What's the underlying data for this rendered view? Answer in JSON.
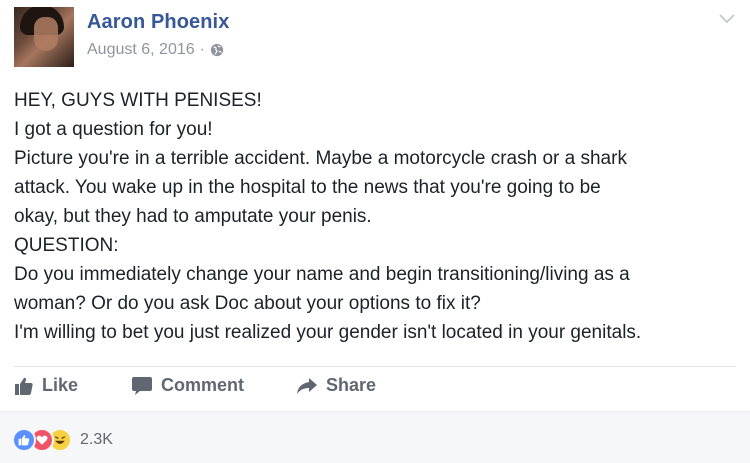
{
  "author": {
    "name": "Aaron Phoenix",
    "date": "August 6, 2016",
    "separator": "·",
    "privacy_icon": "globe-icon",
    "menu_icon": "chevron-down-icon"
  },
  "post": {
    "lines": [
      "HEY, GUYS WITH PENISES!",
      "I got a question for you!",
      "Picture you're in a terrible accident. Maybe a motorcycle crash or a shark",
      "attack. You wake up in the hospital to the news that you're going to be",
      "okay, but they had to amputate your penis.",
      "QUESTION:",
      "Do you immediately change your name and begin transitioning/living as a",
      "woman? Or do you ask Doc about your options to fix it?",
      "I'm willing to bet you just realized your gender isn't located in your genitals."
    ]
  },
  "actions": {
    "like_label": "Like",
    "comment_label": "Comment",
    "share_label": "Share"
  },
  "reactions": {
    "types": [
      "like",
      "love",
      "haha"
    ],
    "count": "2.3K",
    "colors": {
      "like": "#5890ff",
      "love": "#f25268",
      "haha": "#f7d143"
    }
  },
  "colors": {
    "name": "#365899",
    "meta": "#90949c",
    "action": "#606770",
    "footer_bg": "#f6f7f9"
  }
}
